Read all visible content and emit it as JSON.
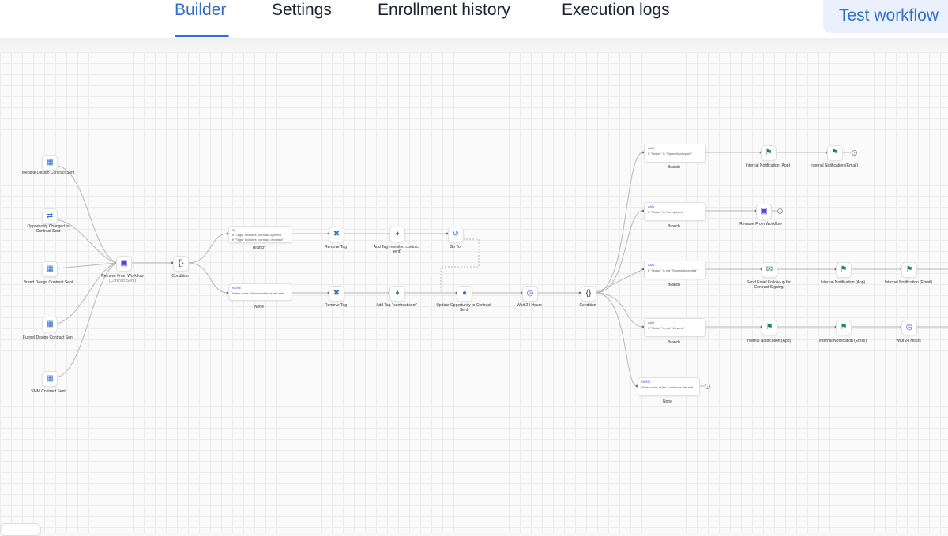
{
  "tabs": [
    {
      "label": "Builder",
      "active": true
    },
    {
      "label": "Settings",
      "active": false
    },
    {
      "label": "Enrollment history",
      "active": false
    },
    {
      "label": "Execution logs",
      "active": false
    }
  ],
  "test_button": "Test workflow",
  "colors": {
    "accent": "#2f6fd6",
    "purple": "#5b3fd6",
    "green": "#1c8a55"
  },
  "triggers": [
    {
      "label": "Website Design Contract Sent",
      "icon": "document-icon"
    },
    {
      "label": "Opportunity Changed to Contract Sent",
      "icon": "swap-arrows-icon"
    },
    {
      "label": "Brand Design Contract Sent",
      "icon": "document-icon"
    },
    {
      "label": "Funnel Design Contract Sent",
      "icon": "document-icon"
    },
    {
      "label": "SMM Contract Sent",
      "icon": "document-icon"
    }
  ],
  "nodes": {
    "remove_wf": {
      "label": "Remove From Workflow",
      "sub": "(Contract Sent)"
    },
    "condition1": {
      "label": "Condition"
    },
    "branch1": {
      "tag": "IF",
      "lines": [
        "If \"Tags\" Includes \"contract ignored\"",
        "If \"Tags\" Includes \"contract declined\""
      ],
      "label": "Branch"
    },
    "none1": {
      "tag": "NONE",
      "lines": [
        "When none of the conditions are met"
      ],
      "label": "None"
    },
    "remove_tag1": {
      "label": "Remove Tag"
    },
    "add_tag1": {
      "label": "Add Tag 'revisited contract sent'"
    },
    "goto": {
      "label": "Go To"
    },
    "remove_tag2": {
      "label": "Remove Tag"
    },
    "add_tag2": {
      "label": "Add Tag ' contract sent'"
    },
    "update_opp": {
      "label": "Update Opportunity to Contract Sent"
    },
    "wait1": {
      "label": "Wait 24 Hours"
    },
    "condition2": {
      "label": "Condition"
    },
    "branch_a": {
      "tag": "AND",
      "lines": [
        "If \"Status\" Is \"Signed/Accepted\""
      ],
      "label": "Branch"
    },
    "branch_b": {
      "tag": "AND",
      "lines": [
        "If \"Status\" Is \"Completed\""
      ],
      "label": "Branch"
    },
    "branch_c": {
      "tag": "AND",
      "lines": [
        "If \"Status\" Is not \"Signed/Accepted\""
      ],
      "label": "Branch"
    },
    "branch_d": {
      "tag": "AND",
      "lines": [
        "If \"Status\" Is not \"Viewed\""
      ],
      "label": "Branch"
    },
    "none2": {
      "tag": "NONE",
      "lines": [
        "When none of the conditions are met"
      ],
      "label": "None"
    },
    "notif_a1": {
      "label": "Internal Notification (App)"
    },
    "notif_a2": {
      "label": "Internal Notification (Email)"
    },
    "remove_wf2": {
      "label": "Remove From Workflow"
    },
    "send_email": {
      "label": "Send Email Follow-up for Contract Signing"
    },
    "notif_c1": {
      "label": "Internal Notification (App)"
    },
    "notif_c2": {
      "label": "Internal Notification (Email)"
    },
    "notif_d1": {
      "label": "Internal Notification (App)"
    },
    "notif_d2": {
      "label": "Internal Notification (Email)"
    },
    "wait2": {
      "label": "Wait 24 Hours"
    }
  }
}
